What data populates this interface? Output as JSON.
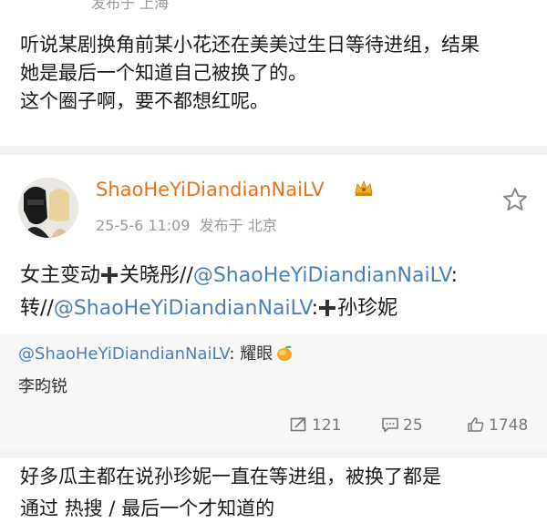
{
  "top_post": {
    "meta_partial": "发布于 上海",
    "lines": [
      "听说某剧换角前某小花还在美美过生日等待进组，结果",
      "她是最后一个知道自己被换了的。",
      "这个圈子啊，要不都想红呢。"
    ]
  },
  "post": {
    "username": "ShaoHeYiDiandianNaiLV",
    "date": "25-5-6 11:09",
    "location": "发布于 北京",
    "line1": {
      "a": "女主变动",
      "b": "关晓彤//",
      "mention": "@ShaoHeYiDiandianNaiLV",
      "c": ":"
    },
    "line2": {
      "a": "转//",
      "mention": "@ShaoHeYiDiandianNaiLV",
      "b": ":",
      "c": "孙珍妮"
    },
    "repost": {
      "mention": "@ShaoHeYiDiandianNaiLV",
      "text": ": 耀眼",
      "line2": "李昀锐"
    },
    "actions": {
      "repost_count": "121",
      "comment_count": "25",
      "like_count": "1748"
    },
    "icons": [
      "star-icon",
      "crown-icon",
      "mango-emoji-icon",
      "repost-icon",
      "comment-icon",
      "like-icon"
    ]
  },
  "bottom_post": {
    "line1": "好多瓜主都在说孙珍妮一直在等进组，被换了都是",
    "line2": "通过 热搜 / 最后一个才知道的"
  }
}
